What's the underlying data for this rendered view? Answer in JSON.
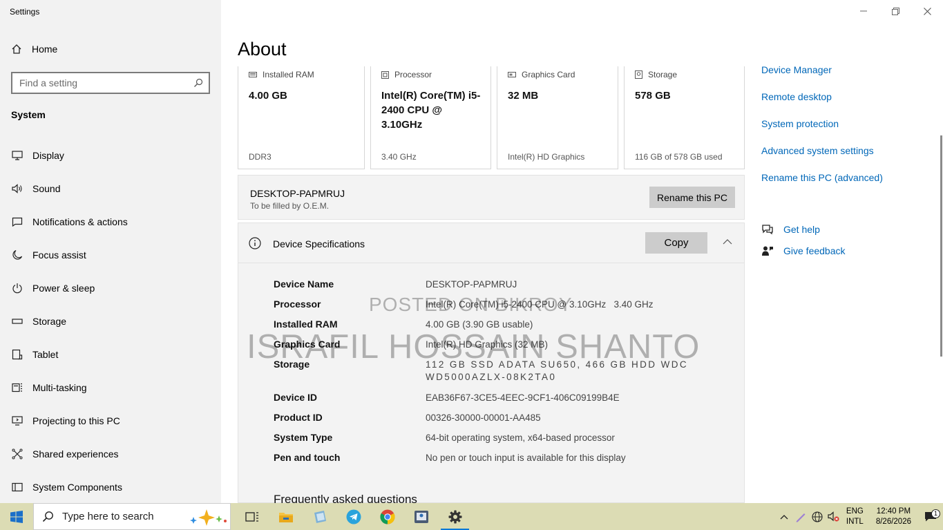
{
  "window": {
    "title": "Settings"
  },
  "sidebar": {
    "home_label": "Home",
    "search_placeholder": "Find a setting",
    "section": "System",
    "items": [
      {
        "label": "Display",
        "icon": "monitor-icon"
      },
      {
        "label": "Sound",
        "icon": "speaker-icon"
      },
      {
        "label": "Notifications & actions",
        "icon": "notification-icon"
      },
      {
        "label": "Focus assist",
        "icon": "moon-icon"
      },
      {
        "label": "Power & sleep",
        "icon": "power-icon"
      },
      {
        "label": "Storage",
        "icon": "storage-icon"
      },
      {
        "label": "Tablet",
        "icon": "tablet-icon"
      },
      {
        "label": "Multi-tasking",
        "icon": "multitasking-icon"
      },
      {
        "label": "Projecting to this PC",
        "icon": "projecting-icon"
      },
      {
        "label": "Shared experiences",
        "icon": "shared-icon"
      },
      {
        "label": "System Components",
        "icon": "components-icon"
      }
    ]
  },
  "main": {
    "title": "About",
    "cards": [
      {
        "label": "Installed RAM",
        "value": "4.00 GB",
        "sub": "DDR3",
        "icon": "ram-icon"
      },
      {
        "label": "Processor",
        "value": "Intel(R) Core(TM) i5-2400 CPU @ 3.10GHz",
        "sub": "3.40 GHz",
        "icon": "cpu-icon"
      },
      {
        "label": "Graphics Card",
        "value": "32 MB",
        "sub": "Intel(R) HD Graphics",
        "icon": "gpu-icon"
      },
      {
        "label": "Storage",
        "value": "578 GB",
        "sub": "116 GB of 578 GB used",
        "icon": "disk-icon"
      }
    ],
    "pc": {
      "name": "DESKTOP-PAPMRUJ",
      "oem": "To be filled by O.E.M.",
      "rename_label": "Rename this PC"
    },
    "specs": {
      "title": "Device Specifications",
      "copy_label": "Copy",
      "rows": [
        {
          "key": "Device Name",
          "value": "DESKTOP-PAPMRUJ"
        },
        {
          "key": "Processor",
          "value": "Intel(R) Core(TM) i5-2400 CPU @ 3.10GHz   3.40 GHz"
        },
        {
          "key": "Installed RAM",
          "value": "4.00 GB (3.90 GB usable)"
        },
        {
          "key": "Graphics Card",
          "value": "Intel(R) HD Graphics (32 MB)"
        },
        {
          "key": "Storage",
          "value": "112 GB SSD ADATA SU650, 466 GB HDD WDC WD5000AZLX-08K2TA0"
        },
        {
          "key": "Device ID",
          "value": "EAB36F67-3CE5-4EEC-9CF1-406C09199B4E"
        },
        {
          "key": "Product ID",
          "value": "00326-30000-00001-AA485"
        },
        {
          "key": "System Type",
          "value": "64-bit operating system, x64-based processor"
        },
        {
          "key": "Pen and touch",
          "value": "No pen or touch input is available for this display"
        }
      ],
      "faq_title": "Frequently asked questions"
    },
    "watermark": {
      "line1": "POSTED ON BIKROY",
      "line2": "ISRAFIL HOSSAIN SHANTO"
    }
  },
  "related": {
    "links": [
      "Device Manager",
      "Remote desktop",
      "System protection",
      "Advanced system settings",
      "Rename this PC (advanced)"
    ],
    "help": [
      {
        "label": "Get help",
        "icon": "help-chat-icon"
      },
      {
        "label": "Give feedback",
        "icon": "feedback-icon"
      }
    ]
  },
  "taskbar": {
    "search_hint": "Type here to search",
    "lang_line1": "ENG",
    "lang_line2": "INTL",
    "time": "12:40 PM",
    "date": "8/26/2026",
    "notification_count": "1"
  },
  "colors": {
    "link": "#0067b8",
    "taskbar": "#dcdcb4",
    "sidebar": "#f2f2f2"
  }
}
